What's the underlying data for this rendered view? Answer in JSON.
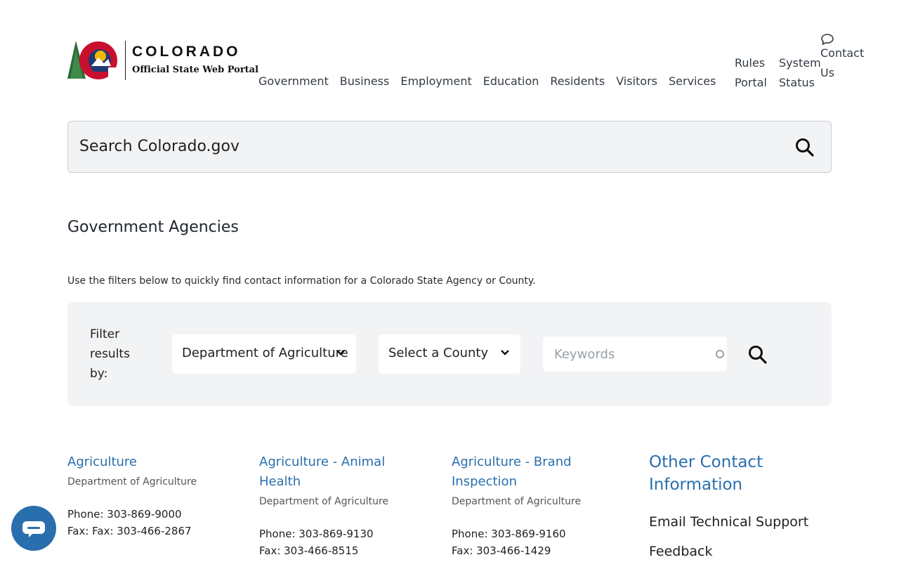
{
  "header": {
    "logo_title": "COLORADO",
    "logo_subtitle": "Official State Web Portal",
    "nav": [
      "Government",
      "Business",
      "Employment",
      "Education",
      "Residents",
      "Visitors",
      "Services"
    ],
    "rules_portal": [
      "Rules",
      "Portal"
    ],
    "system_status": [
      "System",
      "Status"
    ],
    "contact": [
      "Contact",
      "Us"
    ]
  },
  "search": {
    "placeholder": "Search Colorado.gov"
  },
  "page": {
    "title": "Government Agencies",
    "intro": "Use the filters below to quickly find contact information for a Colorado State Agency or County."
  },
  "filter": {
    "label": [
      "Filter",
      "results",
      "by:"
    ],
    "agency_selected": "Department of Agriculture",
    "county_selected": "Select a County",
    "keywords_placeholder": "Keywords"
  },
  "agencies": [
    {
      "name": "Agriculture",
      "dept": "Department of Agriculture",
      "phone": "Phone: 303-869-9000",
      "fax": "Fax: Fax: 303-466-2867"
    },
    {
      "name": "Agriculture - Animal Health",
      "dept": "Department of Agriculture",
      "phone": "Phone: 303-869-9130",
      "fax": "Fax: 303-466-8515"
    },
    {
      "name": "Agriculture - Brand Inspection",
      "dept": "Department of Agriculture",
      "phone": "Phone: 303-869-9160",
      "fax": "Fax: 303-466-1429"
    }
  ],
  "other_contact": {
    "title": "Other Contact Information",
    "links": [
      "Email Technical Support",
      "Feedback"
    ]
  },
  "colors": {
    "link": "#2a6fad",
    "panel": "#f2f3f5",
    "chat": "#2a6fad"
  },
  "icons": [
    "search-icon",
    "chat-bubble-icon",
    "chevron-down-icon",
    "colorado-logo"
  ]
}
